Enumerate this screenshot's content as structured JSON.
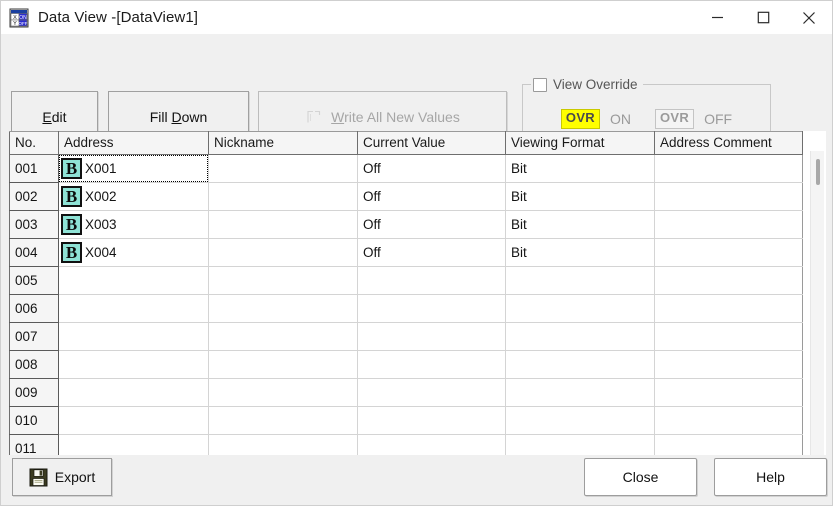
{
  "window": {
    "title": "Data View -[DataView1]",
    "icon": "data-view-icon",
    "controls": {
      "minimize": "minimize-icon",
      "maximize": "maximize-icon",
      "close": "close-icon"
    }
  },
  "toolbar": {
    "edit": {
      "label": "Edit",
      "accel": "E",
      "enabled": true
    },
    "fill_down": {
      "label": "Fill Down",
      "accel": "D",
      "enabled": true
    },
    "write_all": {
      "label": "Write All New Values",
      "accel": "W",
      "enabled": false
    }
  },
  "view_override": {
    "group_title": "View Override",
    "checked": false,
    "on": {
      "badge": "OVR",
      "label": "ON",
      "highlight_color": "#ffff00"
    },
    "off": {
      "badge": "OVR",
      "label": "OFF",
      "highlight_color": "#f4f4f4"
    }
  },
  "grid": {
    "columns": [
      "No.",
      "Address",
      "Nickname",
      "Current Value",
      "Viewing Format",
      "Address Comment"
    ],
    "rows": [
      {
        "no": "001",
        "address": "X001",
        "icon": "B",
        "nickname": "",
        "current_value": "Off",
        "viewing_format": "Bit",
        "address_comment": "",
        "focused": true
      },
      {
        "no": "002",
        "address": "X002",
        "icon": "B",
        "nickname": "",
        "current_value": "Off",
        "viewing_format": "Bit",
        "address_comment": "",
        "focused": false
      },
      {
        "no": "003",
        "address": "X003",
        "icon": "B",
        "nickname": "",
        "current_value": "Off",
        "viewing_format": "Bit",
        "address_comment": "",
        "focused": false
      },
      {
        "no": "004",
        "address": "X004",
        "icon": "B",
        "nickname": "",
        "current_value": "Off",
        "viewing_format": "Bit",
        "address_comment": "",
        "focused": false
      },
      {
        "no": "005",
        "address": "",
        "icon": "",
        "nickname": "",
        "current_value": "",
        "viewing_format": "",
        "address_comment": "",
        "focused": false
      },
      {
        "no": "006",
        "address": "",
        "icon": "",
        "nickname": "",
        "current_value": "",
        "viewing_format": "",
        "address_comment": "",
        "focused": false
      },
      {
        "no": "007",
        "address": "",
        "icon": "",
        "nickname": "",
        "current_value": "",
        "viewing_format": "",
        "address_comment": "",
        "focused": false
      },
      {
        "no": "008",
        "address": "",
        "icon": "",
        "nickname": "",
        "current_value": "",
        "viewing_format": "",
        "address_comment": "",
        "focused": false
      },
      {
        "no": "009",
        "address": "",
        "icon": "",
        "nickname": "",
        "current_value": "",
        "viewing_format": "",
        "address_comment": "",
        "focused": false
      },
      {
        "no": "010",
        "address": "",
        "icon": "",
        "nickname": "",
        "current_value": "",
        "viewing_format": "",
        "address_comment": "",
        "focused": false
      },
      {
        "no": "011",
        "address": "",
        "icon": "",
        "nickname": "",
        "current_value": "",
        "viewing_format": "",
        "address_comment": "",
        "focused": false
      }
    ]
  },
  "footer": {
    "export": {
      "label": "Export",
      "icon": "save-floppy-icon"
    },
    "close": {
      "label": "Close"
    },
    "help": {
      "label": "Help"
    }
  }
}
